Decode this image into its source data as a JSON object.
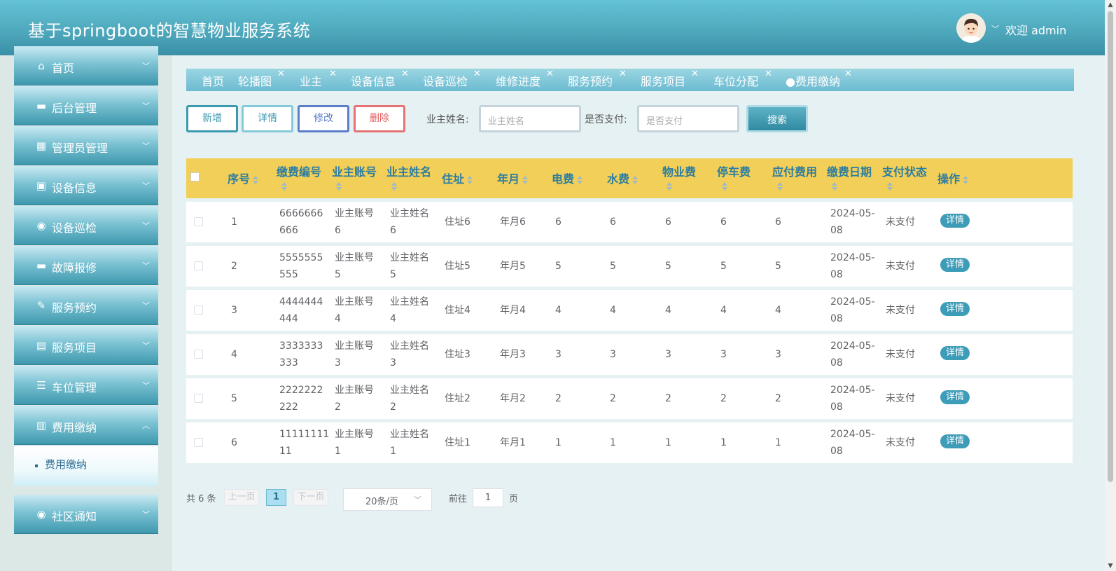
{
  "header": {
    "title": "基于springboot的智慧物业服务系统",
    "welcome": "欢迎 admin"
  },
  "sidebar": {
    "items": [
      {
        "label": "首页",
        "icon": "home-icon"
      },
      {
        "label": "后台管理",
        "icon": "archive-icon"
      },
      {
        "label": "管理员管理",
        "icon": "grid-icon"
      },
      {
        "label": "设备信息",
        "icon": "briefcase-icon"
      },
      {
        "label": "设备巡检",
        "icon": "target-icon"
      },
      {
        "label": "故障报修",
        "icon": "box-icon"
      },
      {
        "label": "服务预约",
        "icon": "pen-icon"
      },
      {
        "label": "服务项目",
        "icon": "layout-icon"
      },
      {
        "label": "车位管理",
        "icon": "list-icon"
      },
      {
        "label": "费用缴纳",
        "icon": "stack-icon"
      },
      {
        "label": "社区通知",
        "icon": "target-icon"
      }
    ],
    "active_sub": "费用缴纳"
  },
  "tabs": [
    "首页",
    "轮播图",
    "业主",
    "设备信息",
    "设备巡检",
    "维修进度",
    "服务预约",
    "服务项目",
    "车位分配",
    "●费用缴纳"
  ],
  "actions": {
    "add": "新增",
    "detail": "详情",
    "edit": "修改",
    "delete": "删除",
    "search": "搜索"
  },
  "filters": {
    "owner_name_label": "业主姓名:",
    "owner_name_placeholder": "业主姓名",
    "paid_label": "是否支付:",
    "paid_placeholder": "是否支付"
  },
  "table": {
    "columns": [
      "序号",
      "缴费编号",
      "业主账号",
      "业主姓名",
      "住址",
      "年月",
      "电费",
      "水费",
      "物业费",
      "停车费",
      "应付费用",
      "缴费日期",
      "支付状态",
      "操作"
    ],
    "rows": [
      {
        "index": "1",
        "code_a": "6666666",
        "code_b": "666",
        "acct_a": "业主账号",
        "acct_b": "6",
        "name_a": "业主姓名",
        "name_b": "6",
        "address": "住址6",
        "month": "年月6",
        "elec": "6",
        "water": "6",
        "property": "6",
        "parking": "6",
        "due": "6",
        "date_a": "2024-05-",
        "date_b": "08",
        "status": "未支付",
        "op": "详情"
      },
      {
        "index": "2",
        "code_a": "5555555",
        "code_b": "555",
        "acct_a": "业主账号",
        "acct_b": "5",
        "name_a": "业主姓名",
        "name_b": "5",
        "address": "住址5",
        "month": "年月5",
        "elec": "5",
        "water": "5",
        "property": "5",
        "parking": "5",
        "due": "5",
        "date_a": "2024-05-",
        "date_b": "08",
        "status": "未支付",
        "op": "详情"
      },
      {
        "index": "3",
        "code_a": "4444444",
        "code_b": "444",
        "acct_a": "业主账号",
        "acct_b": "4",
        "name_a": "业主姓名",
        "name_b": "4",
        "address": "住址4",
        "month": "年月4",
        "elec": "4",
        "water": "4",
        "property": "4",
        "parking": "4",
        "due": "4",
        "date_a": "2024-05-",
        "date_b": "08",
        "status": "未支付",
        "op": "详情"
      },
      {
        "index": "4",
        "code_a": "3333333",
        "code_b": "333",
        "acct_a": "业主账号",
        "acct_b": "3",
        "name_a": "业主姓名",
        "name_b": "3",
        "address": "住址3",
        "month": "年月3",
        "elec": "3",
        "water": "3",
        "property": "3",
        "parking": "3",
        "due": "3",
        "date_a": "2024-05-",
        "date_b": "08",
        "status": "未支付",
        "op": "详情"
      },
      {
        "index": "5",
        "code_a": "2222222",
        "code_b": "222",
        "acct_a": "业主账号",
        "acct_b": "2",
        "name_a": "业主姓名",
        "name_b": "2",
        "address": "住址2",
        "month": "年月2",
        "elec": "2",
        "water": "2",
        "property": "2",
        "parking": "2",
        "due": "2",
        "date_a": "2024-05-",
        "date_b": "08",
        "status": "未支付",
        "op": "详情"
      },
      {
        "index": "6",
        "code_a": "11111111",
        "code_b": "11",
        "acct_a": "业主账号",
        "acct_b": "1",
        "name_a": "业主姓名",
        "name_b": "1",
        "address": "住址1",
        "month": "年月1",
        "elec": "1",
        "water": "1",
        "property": "1",
        "parking": "1",
        "due": "1",
        "date_a": "2024-05-",
        "date_b": "08",
        "status": "未支付",
        "op": "详情"
      }
    ]
  },
  "pagination": {
    "total": "共 6 条",
    "prev": "上一页",
    "current": "1",
    "next": "下一页",
    "page_size": "20条/页",
    "goto_label": "前往",
    "goto_value": "1",
    "page_unit": "页"
  },
  "colors": {
    "accent": "#4fa9bd",
    "table_header": "#f1cf58",
    "header_text": "#2d7da0"
  }
}
